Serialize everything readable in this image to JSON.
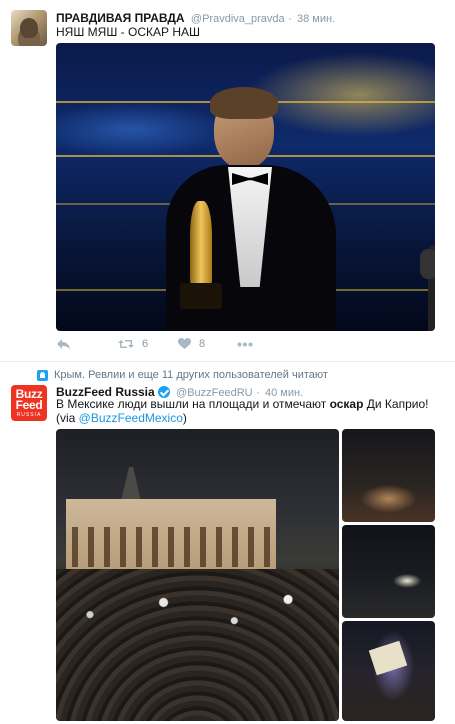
{
  "tweets": [
    {
      "fullname": "ПРАВДИВАЯ ПРАВДА",
      "handle": "@Pravdiva_pravda",
      "separator": "·",
      "time": "38 мин.",
      "text": "НЯШ МЯШ - ОСКАР НАШ",
      "actions": {
        "reply_icon": "reply-icon",
        "retweet_icon": "retweet-icon",
        "retweet_count": "6",
        "like_icon": "heart-icon",
        "like_count": "8",
        "more_icon": "more-icon"
      }
    },
    {
      "context": "Крым. Ревлии и еще 11 других пользователей читают",
      "fullname": "BuzzFeed Russia",
      "handle": "@BuzzFeedRU",
      "separator": "·",
      "time": "40 мин.",
      "text_before": "В Мексике люди вышли на площади и отмечают ",
      "text_keyword": "оскар",
      "text_after": " Ди Каприо! (via ",
      "text_mention": "@BuzzFeedMexico",
      "text_end": ")",
      "avatar_line1": "Buzz",
      "avatar_line2": "Feed",
      "avatar_line3": "RUSSIA"
    }
  ],
  "colors": {
    "link": "#1b95e0",
    "secondary_text": "#8899a6",
    "verified": "#1da1f2",
    "buzzfeed_red": "#ee3322"
  }
}
